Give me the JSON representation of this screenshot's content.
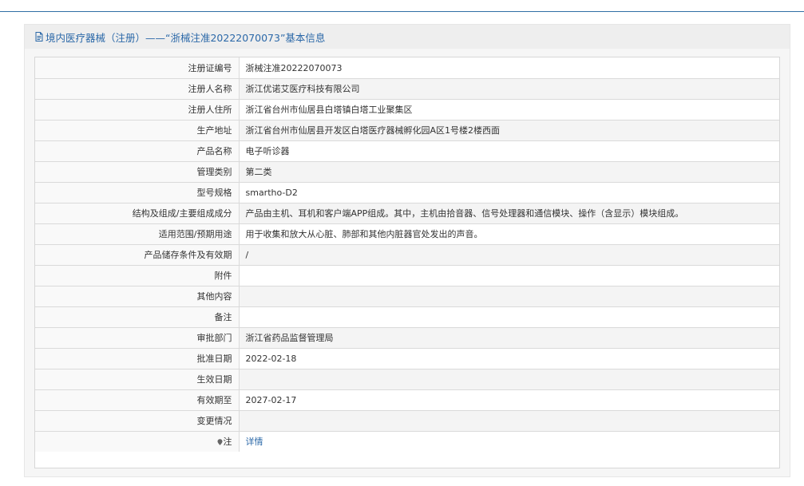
{
  "header": {
    "title": "境内医疗器械（注册）——“浙械注准20222070073”基本信息"
  },
  "rows": [
    {
      "label": "注册证编号",
      "value": "浙械注准20222070073"
    },
    {
      "label": "注册人名称",
      "value": "浙江优诺艾医疗科技有限公司"
    },
    {
      "label": "注册人住所",
      "value": "浙江省台州市仙居县白塔镇白塔工业聚集区"
    },
    {
      "label": "生产地址",
      "value": "浙江省台州市仙居县开发区白塔医疗器械孵化园A区1号楼2楼西面"
    },
    {
      "label": "产品名称",
      "value": "电子听诊器"
    },
    {
      "label": "管理类别",
      "value": "第二类"
    },
    {
      "label": "型号规格",
      "value": "smartho-D2"
    },
    {
      "label": "结构及组成/主要组成成分",
      "value": "产品由主机、耳机和客户端APP组成。其中，主机由拾音器、信号处理器和通信模块、操作（含显示）模块组成。"
    },
    {
      "label": "适用范围/预期用途",
      "value": "用于收集和放大从心脏、肺部和其他内脏器官处发出的声音。"
    },
    {
      "label": "产品储存条件及有效期",
      "value": "/"
    },
    {
      "label": "附件",
      "value": ""
    },
    {
      "label": "其他内容",
      "value": ""
    },
    {
      "label": "备注",
      "value": ""
    },
    {
      "label": "审批部门",
      "value": "浙江省药品监督管理局"
    },
    {
      "label": "批准日期",
      "value": "2022-02-18"
    },
    {
      "label": "生效日期",
      "value": ""
    },
    {
      "label": "有效期至",
      "value": "2027-02-17"
    },
    {
      "label": "变更情况",
      "value": ""
    }
  ],
  "note": {
    "label": "注",
    "link_text": "详情",
    "icon": "map-pin-icon"
  },
  "colors": {
    "accent": "#2b68a8",
    "top_rule": "#2f6ea5"
  }
}
